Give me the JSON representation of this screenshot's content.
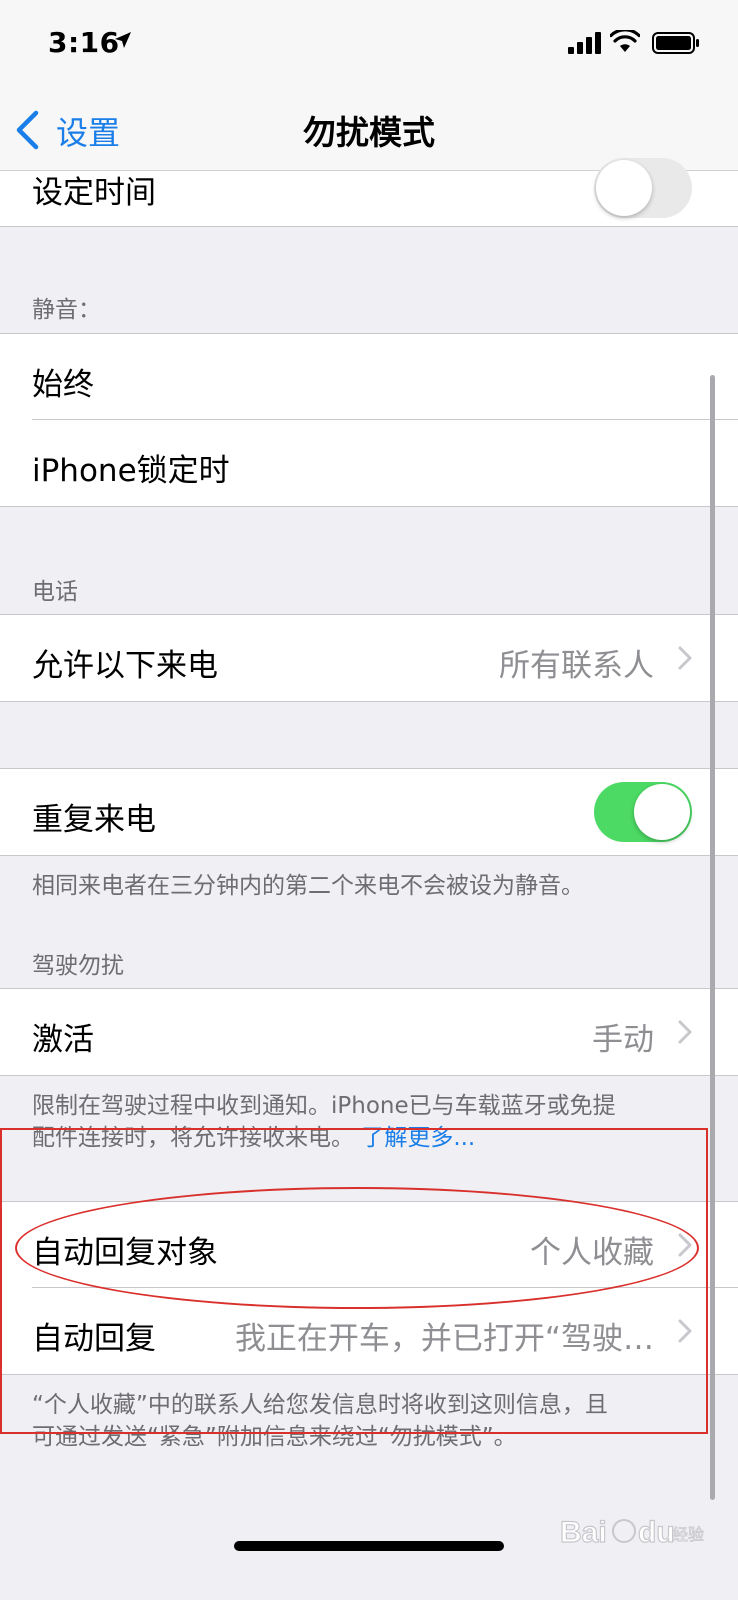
{
  "status_bar": {
    "time": "3:16"
  },
  "nav": {
    "back_label": "设置",
    "title": "勿扰模式"
  },
  "scheduled": {
    "label": "设定时间",
    "enabled": false
  },
  "silence": {
    "header": "静音：",
    "options": [
      "始终",
      "iPhone锁定时"
    ]
  },
  "phone": {
    "header": "电话",
    "allow_calls_label": "允许以下来电",
    "allow_calls_value": "所有联系人"
  },
  "repeated_calls": {
    "label": "重复来电",
    "enabled": true,
    "footer": "相同来电者在三分钟内的第二个来电不会被设为静音。"
  },
  "driving": {
    "header": "驾驶勿扰",
    "activate_label": "激活",
    "activate_value": "手动",
    "footer_line1": "限制在驾驶过程中收到通知。iPhone已与车载蓝牙或免提",
    "footer_line2": "配件连接时，将允许接收来电。",
    "footer_link": "了解更多..."
  },
  "auto_reply": {
    "to_label": "自动回复对象",
    "to_value": "个人收藏",
    "reply_label": "自动回复",
    "reply_value": "我正在开车，并已打开“驾驶…",
    "footer_line1": "“个人收藏”中的联系人给您发信息时将收到这则信息，且",
    "footer_line2": "可通过发送“紧急”附加信息来绕过“勿扰模式”。"
  },
  "colors": {
    "accent": "#1a7ee8",
    "toggle_on": "#4cd964",
    "annotation": "#d9302c",
    "background": "#efeff4"
  },
  "watermark": {
    "text": "Baidu经验"
  }
}
